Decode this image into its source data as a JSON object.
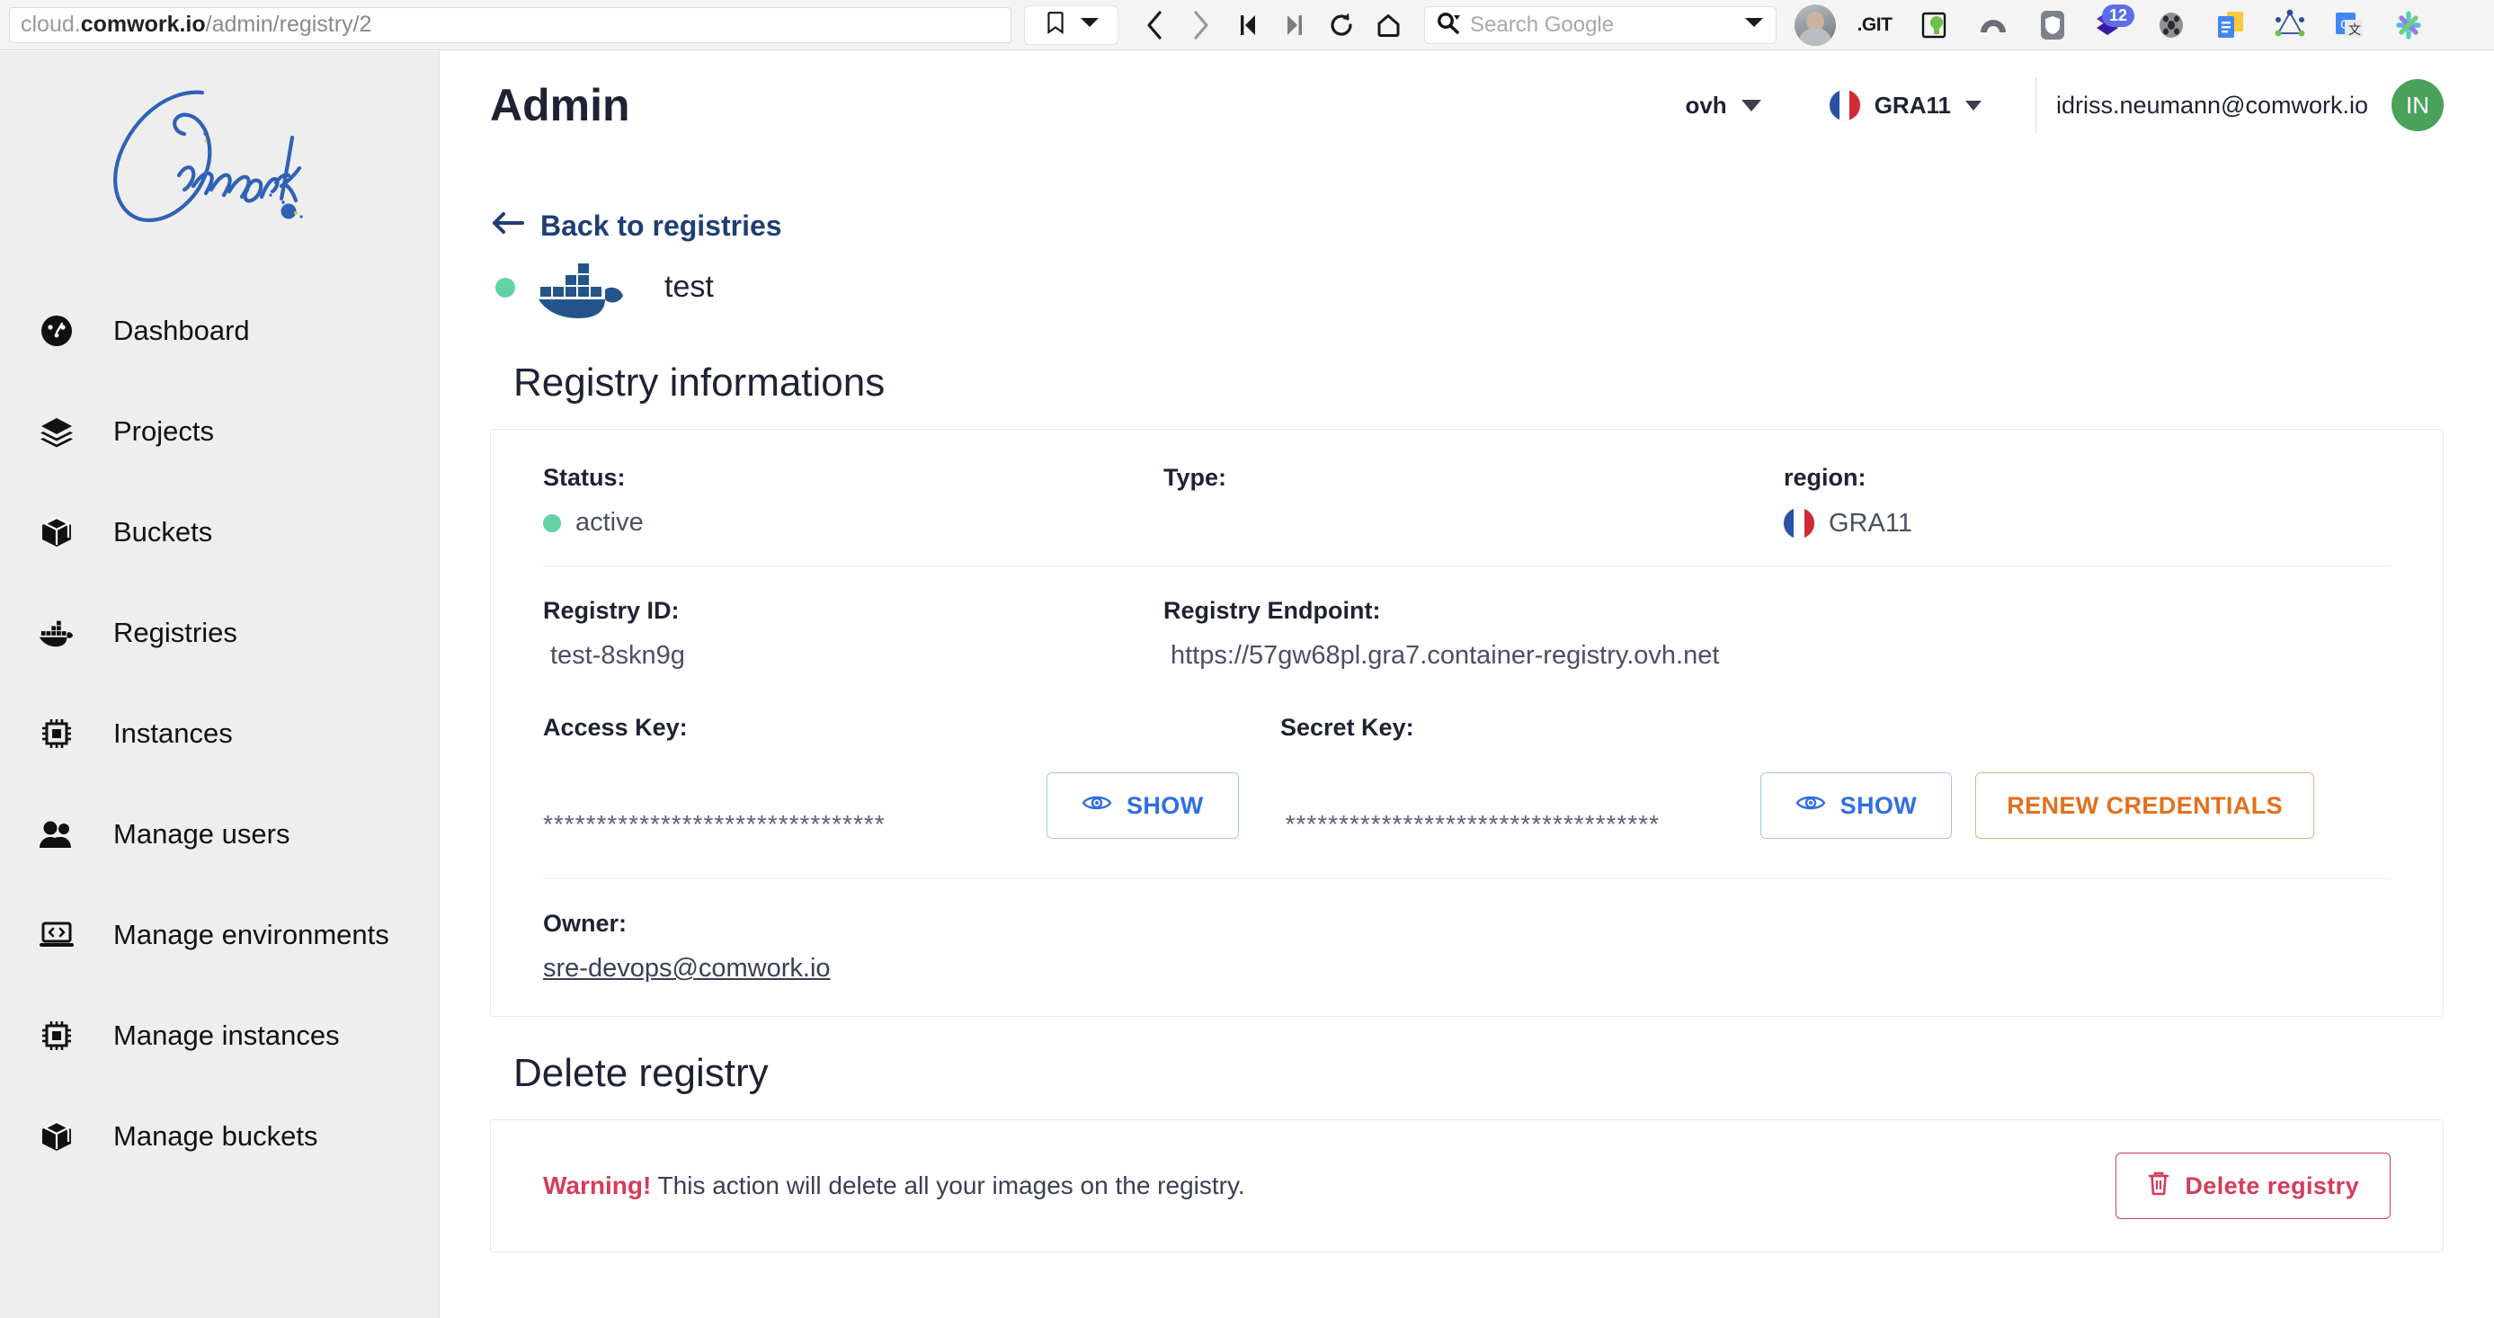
{
  "browser": {
    "url_prefix": "cloud.",
    "url_domain": "comwork.io",
    "url_path": "/admin/registry/2",
    "bookmark_icon": "bookmark-icon",
    "nav": [
      {
        "name": "back-button",
        "icon": "chevron-left-icon"
      },
      {
        "name": "forward-button",
        "icon": "chevron-right-icon"
      },
      {
        "name": "first-page-button",
        "icon": "skip-back-icon"
      },
      {
        "name": "last-page-button",
        "icon": "skip-forward-icon"
      },
      {
        "name": "reload-button",
        "icon": "reload-icon"
      },
      {
        "name": "home-button",
        "icon": "home-icon"
      }
    ],
    "search_placeholder": "Search Google",
    "extensions": [
      {
        "name": "profile-avatar",
        "label": ""
      },
      {
        "name": "git-extension",
        "label": ".GIT"
      },
      {
        "name": "bitwarden-extension",
        "label": ""
      },
      {
        "name": "nordvpn-extension",
        "label": ""
      },
      {
        "name": "shield-extension",
        "label": ""
      },
      {
        "name": "layers-extension",
        "label": "",
        "badge": "12"
      },
      {
        "name": "film-reel-extension",
        "label": ""
      },
      {
        "name": "google-docs-extension",
        "label": ""
      },
      {
        "name": "graphql-extension",
        "label": ""
      },
      {
        "name": "google-translate-extension",
        "label": ""
      },
      {
        "name": "slack-extension",
        "label": ""
      }
    ]
  },
  "sidebar": {
    "logo_text": "Comwork",
    "items": [
      {
        "label": "Dashboard",
        "icon": "dashboard-icon"
      },
      {
        "label": "Projects",
        "icon": "layers-icon"
      },
      {
        "label": "Buckets",
        "icon": "cube-icon"
      },
      {
        "label": "Registries",
        "icon": "docker-icon"
      },
      {
        "label": "Instances",
        "icon": "cpu-icon"
      },
      {
        "label": "Manage users",
        "icon": "users-icon"
      },
      {
        "label": "Manage environments",
        "icon": "laptop-code-icon"
      },
      {
        "label": "Manage instances",
        "icon": "cpu-icon"
      },
      {
        "label": "Manage buckets",
        "icon": "cube-icon"
      }
    ]
  },
  "header": {
    "title": "Admin",
    "provider": "ovh",
    "region": "GRA11",
    "user_email": "idriss.neumann@comwork.io",
    "user_initials": "IN"
  },
  "page": {
    "back_label": "Back to registries",
    "registry_name": "test",
    "registry_status_color": "#62d2a6"
  },
  "info": {
    "section_title": "Registry informations",
    "status_label": "Status:",
    "status_value": "active",
    "type_label": "Type:",
    "type_value": "",
    "region_label": "region:",
    "region_value": "GRA11",
    "registry_id_label": "Registry ID:",
    "registry_id_value": "test-8skn9g",
    "endpoint_label": "Registry Endpoint:",
    "endpoint_value": "https://57gw68pl.gra7.container-registry.ovh.net",
    "access_key_label": "Access Key:",
    "access_key_value": "********************************",
    "secret_key_label": "Secret Key:",
    "secret_key_value": "***********************************",
    "show_label": "SHOW",
    "renew_label": "RENEW CREDENTIALS",
    "owner_label": "Owner:",
    "owner_value": "sre-devops@comwork.io"
  },
  "delete": {
    "section_title": "Delete registry",
    "warning_bold": "Warning!",
    "warning_text": " This action will delete all your images on the registry.",
    "delete_label": "Delete registry"
  }
}
